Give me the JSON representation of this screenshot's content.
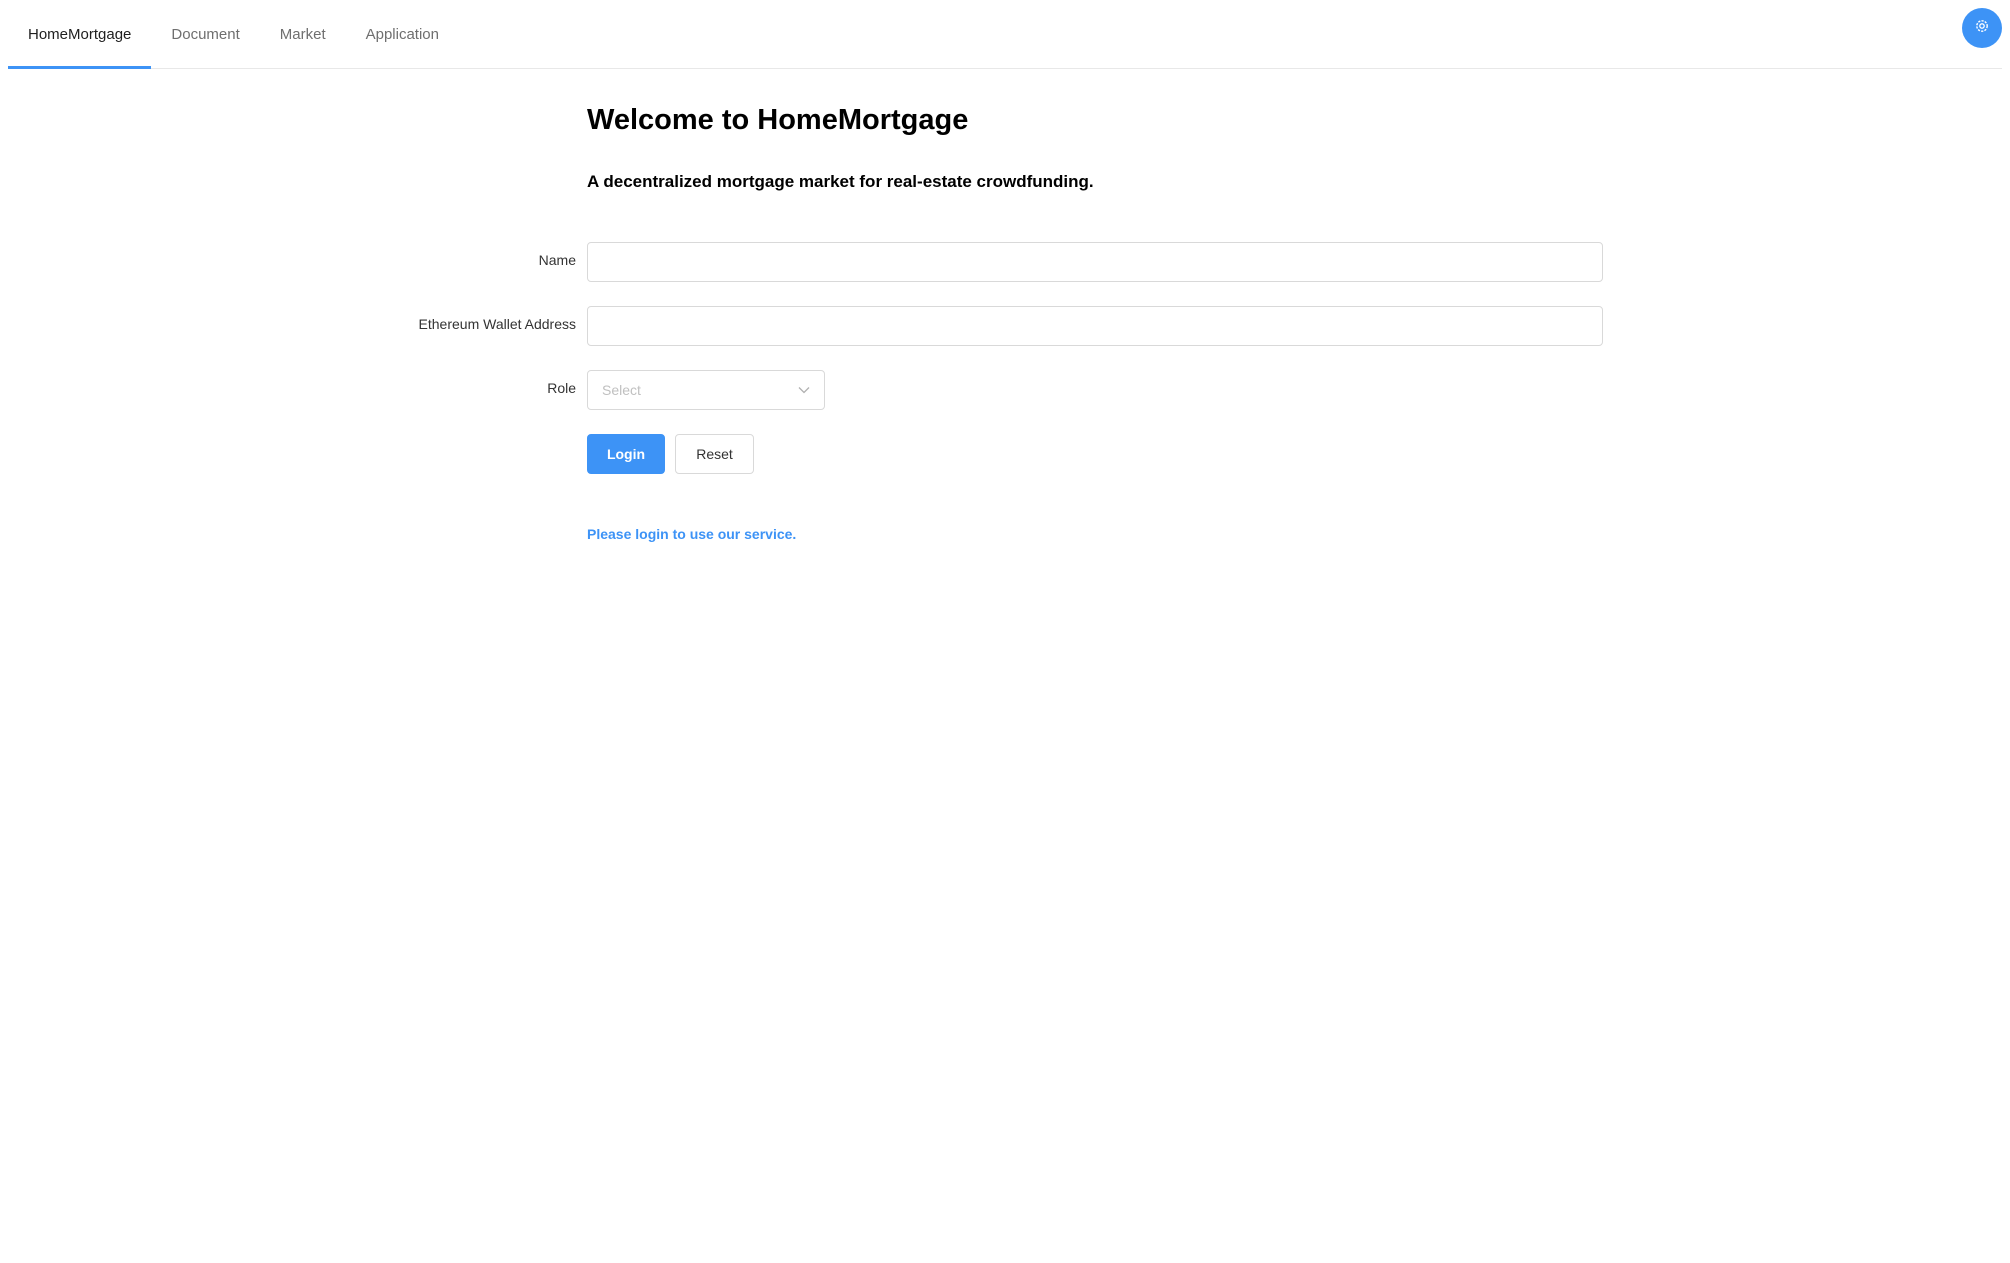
{
  "nav": {
    "tabs": [
      {
        "label": "HomeMortgage",
        "active": true
      },
      {
        "label": "Document",
        "active": false
      },
      {
        "label": "Market",
        "active": false
      },
      {
        "label": "Application",
        "active": false
      }
    ],
    "settings_icon": "gear-icon"
  },
  "main": {
    "title": "Welcome to HomeMortgage",
    "subtitle": "A decentralized mortgage market for real-estate crowdfunding.",
    "form": {
      "name_label": "Name",
      "name_value": "",
      "wallet_label": "Ethereum Wallet Address",
      "wallet_value": "",
      "role_label": "Role",
      "role_placeholder": "Select",
      "login_label": "Login",
      "reset_label": "Reset"
    },
    "notice": "Please login to use our service."
  },
  "colors": {
    "accent": "#3d93f6",
    "border": "#d9d9d9",
    "placeholder": "#c0c0c0"
  }
}
